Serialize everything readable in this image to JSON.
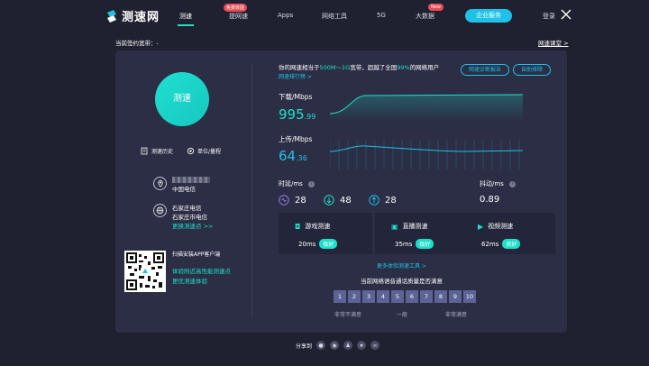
{
  "nav": {
    "logo_text": "测速网",
    "items": [
      {
        "label": "测速",
        "active": true
      },
      {
        "label": "提网速",
        "badge": "免费体验"
      },
      {
        "label": "Apps"
      },
      {
        "label": "网络工具"
      },
      {
        "label": "5G"
      },
      {
        "label": "大数据",
        "badge": "New"
      }
    ],
    "enterprise_label": "企业服务",
    "login_label": "登录"
  },
  "info": {
    "broadband": "当前签约宽带：-",
    "classroom_link": "网速课堂 >"
  },
  "left": {
    "start_button": "测速",
    "history_label": "测速历史",
    "units_label": "单位/量程",
    "isp": "中国电信",
    "server_line1": "石家庄电信",
    "server_line2": "石家庄市电信",
    "change_server": "更换测速点 >>",
    "app_title": "扫描安装APP客户端",
    "app_desc1": "体验附近高性能测速点",
    "app_desc2": "更优测速体验"
  },
  "right": {
    "summary_prefix": "你的网速相当于",
    "summary_range": "500M～1G",
    "summary_mid": "宽带，超越了全国",
    "summary_pct": "99%",
    "summary_suffix": "的网络用户",
    "rank_link": "网速排行榜 >",
    "diagnose_btn": "网速诊断报告",
    "troubleshoot_btn": "自助排障",
    "download_label": "下载/Mbps",
    "download_int": "995",
    "download_dec": ".99",
    "upload_label": "上传/Mbps",
    "upload_int": "64",
    "upload_dec": ".36",
    "latency_label": "时延/ms",
    "latency_idle": "28",
    "latency_down": "48",
    "latency_up": "28",
    "jitter_label": "抖动/ms",
    "jitter_value": "0.89",
    "services": [
      {
        "title": "游戏测速",
        "value": "20ms",
        "grade": "极好"
      },
      {
        "title": "直播测速",
        "value": "35ms",
        "grade": "极好"
      },
      {
        "title": "视频测速",
        "value": "62ms",
        "grade": "良好"
      }
    ],
    "more_tools": "更多体验测速工具 >",
    "survey_question": "当前网络语音通话质量是否满意",
    "scale": [
      "1",
      "2",
      "3",
      "4",
      "5",
      "6",
      "7",
      "8",
      "9",
      "10"
    ],
    "scale_low": "非常不满意",
    "scale_mid": "一般",
    "scale_high": "非常满意"
  },
  "share": {
    "label": "分享到"
  },
  "colors": {
    "accent": "#1ee0c9",
    "blue": "#1ec2e8",
    "panel": "#2b2e45",
    "bg": "#1f2130"
  }
}
